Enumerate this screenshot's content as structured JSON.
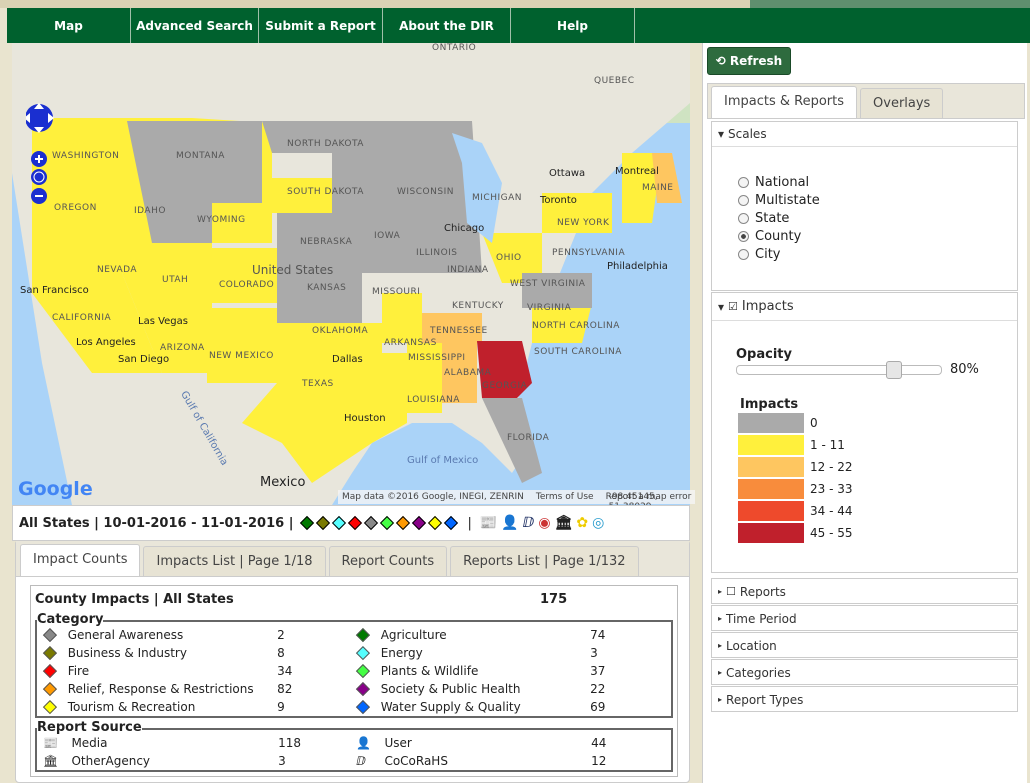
{
  "nav": [
    "Map",
    "Advanced Search",
    "Submit a Report",
    "About the DIR",
    "Help"
  ],
  "map": {
    "state_labels": [
      "WASHINGTON",
      "MONTANA",
      "NORTH DAKOTA",
      "OREGON",
      "IDAHO",
      "SOUTH DAKOTA",
      "WYOMING",
      "NEBRASKA",
      "IOWA",
      "WISCONSIN",
      "MICHIGAN",
      "NEVADA",
      "UTAH",
      "COLORADO",
      "KANSAS",
      "MISSOURI",
      "ILLINOIS",
      "INDIANA",
      "OHIO",
      "CALIFORNIA",
      "ARIZONA",
      "NEW MEXICO",
      "OKLAHOMA",
      "ARKANSAS",
      "TENNESSEE",
      "KENTUCKY",
      "NORTH CAROLINA",
      "SOUTH CAROLINA",
      "TEXAS",
      "MISSISSIPPI",
      "ALABAMA",
      "GEORGIA",
      "LOUISIANA",
      "FLORIDA",
      "NEW YORK",
      "PENNSYLVANIA",
      "MAINE",
      "ONTARIO",
      "QUEBEC",
      "VIRGINIA",
      "WEST VIRGINIA"
    ],
    "cities": [
      "United States",
      "San Francisco",
      "Las Vegas",
      "Los Angeles",
      "San Diego",
      "Dallas",
      "Houston",
      "Chicago",
      "Toronto",
      "Ottawa",
      "Montreal",
      "Philadelphia",
      "Mexico",
      "Gulf of Mexico",
      "Gulf of California"
    ],
    "logo": "Google",
    "attribution": "Map data ©2016 Google, INEGI, ZENRIN",
    "terms": "Terms of Use",
    "report_error": "Report a map error",
    "coords": "-98.45145, 51.38029"
  },
  "infobar": {
    "text": "All States | 10-01-2016 - 11-01-2016 |",
    "diamond_colors": [
      "#007a00",
      "#7a7a00",
      "#5ff",
      "#f00",
      "#888",
      "#4f4",
      "#f90",
      "#808",
      "#ff0",
      "#06f"
    ],
    "separator": "|",
    "source_icons": [
      "media-icon",
      "user-icon",
      "cocorahs-icon",
      "nws-icon",
      "other-agency-icon",
      "flower-icon",
      "disc-icon"
    ]
  },
  "tabs": [
    "Impact Counts",
    "Impacts List | Page 1/18",
    "Report Counts",
    "Reports List | Page 1/132"
  ],
  "counts": {
    "title": "County Impacts | All States",
    "total": "175",
    "category_label": "Category",
    "categories": [
      {
        "name": "General Awareness",
        "value": "2",
        "color": "#888"
      },
      {
        "name": "Agriculture",
        "value": "74",
        "color": "#007a00"
      },
      {
        "name": "Business & Industry",
        "value": "8",
        "color": "#7a7a00"
      },
      {
        "name": "Energy",
        "value": "3",
        "color": "#5ff"
      },
      {
        "name": "Fire",
        "value": "34",
        "color": "#f00"
      },
      {
        "name": "Plants & Wildlife",
        "value": "37",
        "color": "#4f4"
      },
      {
        "name": "Relief, Response & Restrictions",
        "value": "82",
        "color": "#f90"
      },
      {
        "name": "Society & Public Health",
        "value": "22",
        "color": "#808"
      },
      {
        "name": "Tourism & Recreation",
        "value": "9",
        "color": "#ff0"
      },
      {
        "name": "Water Supply & Quality",
        "value": "69",
        "color": "#06f"
      }
    ],
    "source_label": "Report Source",
    "sources": [
      {
        "name": "Media",
        "value": "118",
        "icon": "media-icon"
      },
      {
        "name": "User",
        "value": "44",
        "icon": "user-icon"
      },
      {
        "name": "OtherAgency",
        "value": "3",
        "icon": "other-agency-icon"
      },
      {
        "name": "CoCoRaHS",
        "value": "12",
        "icon": "cocorahs-icon"
      }
    ]
  },
  "right": {
    "refresh": "Refresh",
    "tabs": [
      "Impacts & Reports",
      "Overlays"
    ],
    "scales": {
      "title": "Scales",
      "options": [
        "National",
        "Multistate",
        "State",
        "County",
        "City"
      ],
      "selected": "County"
    },
    "impacts": {
      "title": "Impacts",
      "checked": true,
      "opacity_label": "Opacity",
      "opacity": "80%",
      "opacity_value": 80,
      "legend_title": "Impacts",
      "legend": [
        {
          "label": "0",
          "color": "#aaaaaa"
        },
        {
          "label": "1 - 11",
          "color": "#fff03c"
        },
        {
          "label": "12 - 22",
          "color": "#fec660"
        },
        {
          "label": "23 - 33",
          "color": "#f88c3c"
        },
        {
          "label": "34 - 44",
          "color": "#ee4a2c"
        },
        {
          "label": "45 - 55",
          "color": "#c0202c"
        }
      ]
    },
    "collapsed": [
      "Reports",
      "Time Period",
      "Location",
      "Categories",
      "Report Types"
    ]
  }
}
